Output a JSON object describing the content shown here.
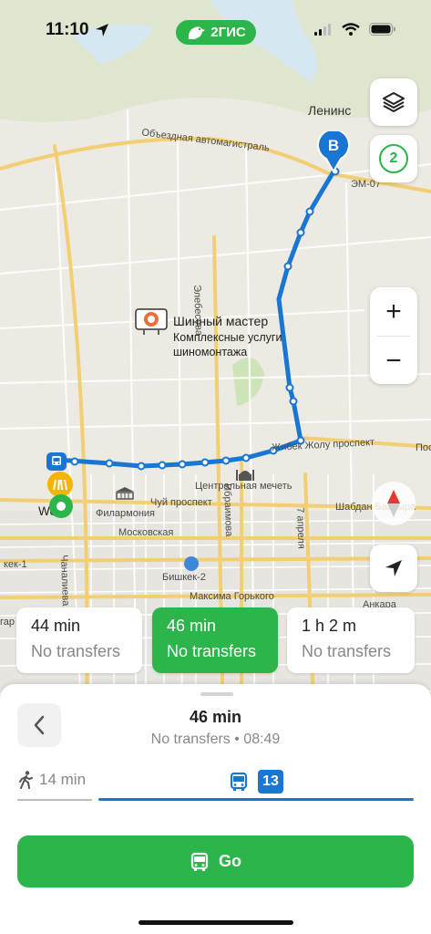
{
  "status_bar": {
    "time": "11:10"
  },
  "brand": {
    "name": "2ГИС"
  },
  "map": {
    "labels": {
      "city_lenin": "Ленинс",
      "road_bypass": "Объездная автомагистраль",
      "road_em07": "ЭМ-07",
      "street_elebesova": "Элебесова",
      "poi_name": "Шинный мастер",
      "poi_desc_line1": "Комплексные услуги",
      "poi_desc_line2": "шиномонтажа",
      "street_zhibek": "Жибек Жолу проспект",
      "street_pos": "Пос",
      "central_mosque": "Центральная мечеть",
      "street_chuy": "Чуй проспект",
      "philharmonic": "Филармония",
      "street_shabdan": "Шабдан Баатыра",
      "street_moskovskaya": "Московская",
      "street_ibraimova": "Ибраимова",
      "street_7april": "7 апреля",
      "street_chanalieva": "Чаналиева",
      "bishkek1": "кек-1",
      "bishkek2": "Бишкек-2",
      "street_gorkogo": "Максима Горького",
      "street_ankara": "Анкара",
      "street_egar": "гар",
      "start_label": "West"
    },
    "destination_marker": "B",
    "route_count": "2"
  },
  "controls": {
    "layers_icon": "layers-icon",
    "zoom_in": "+",
    "zoom_out": "−",
    "compass_icon": "compass-icon",
    "locate_icon": "location-arrow-icon"
  },
  "route_options": [
    {
      "duration": "44 min",
      "transfers": "No transfers",
      "active": false
    },
    {
      "duration": "46 min",
      "transfers": "No transfers",
      "active": true
    },
    {
      "duration": "1 h 2 m",
      "transfers": "No transfers",
      "active": false
    }
  ],
  "sheet": {
    "title": "46 min",
    "subtitle": "No transfers • 08:49",
    "walk_time": "14 min",
    "bus_route": "13",
    "go_label": "Go"
  },
  "colors": {
    "brand_green": "#2cb54a",
    "route_blue": "#1976d2"
  }
}
